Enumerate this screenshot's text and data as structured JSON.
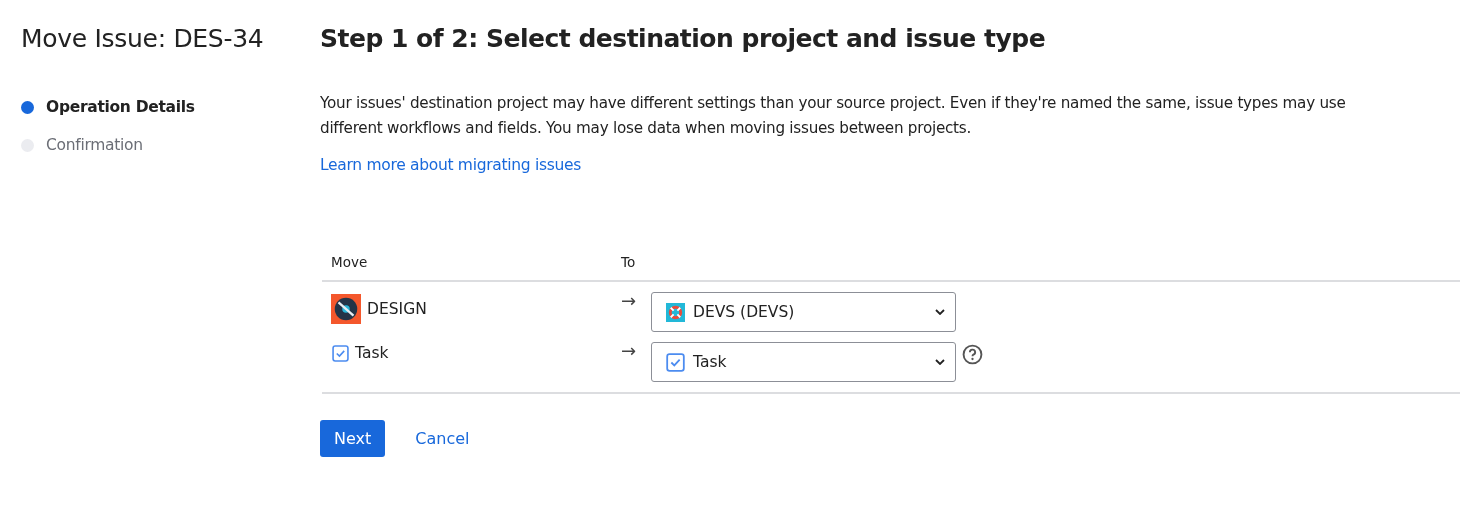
{
  "page_title": "Move Issue: DES-34",
  "steps": [
    {
      "label": "Operation Details",
      "selected": true
    },
    {
      "label": "Confirmation",
      "selected": false
    }
  ],
  "heading": "Step 1 of 2: Select destination project and issue type",
  "description": "Your issues' destination project may have different settings than your source project. Even if they're named the same, issue types may use different workflows and fields. You may lose data when moving issues between projects.",
  "learn_more_link": "Learn more about migrating issues",
  "table": {
    "columns": [
      "Move",
      "To"
    ],
    "rows": [
      {
        "kind": "project",
        "source": "DESIGN",
        "arrow": "→",
        "destination": "DEVS (DEVS)",
        "help": false
      },
      {
        "kind": "issue_type",
        "source": "Task",
        "arrow": "→",
        "destination": "Task",
        "help": true
      }
    ]
  },
  "buttons": {
    "next": "Next",
    "cancel": "Cancel"
  }
}
